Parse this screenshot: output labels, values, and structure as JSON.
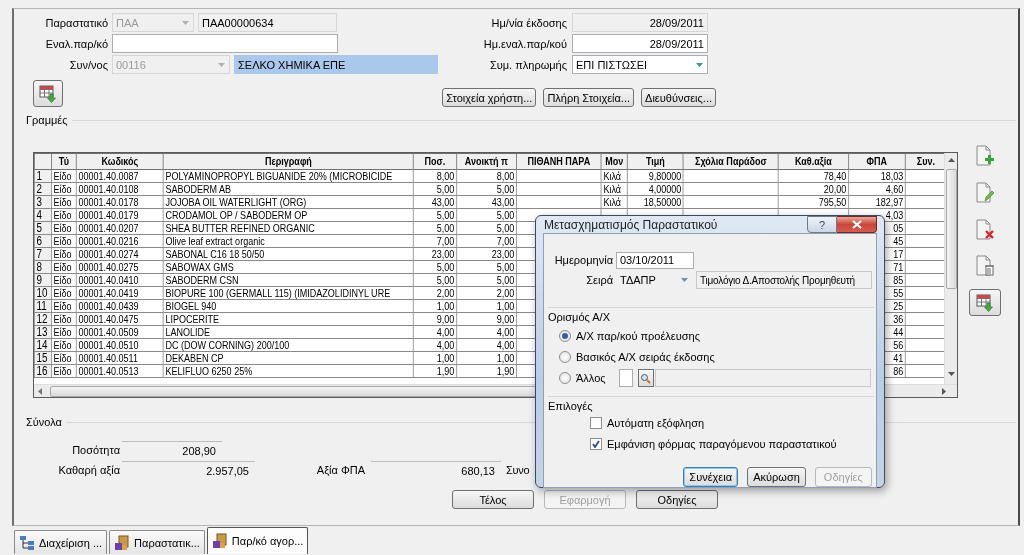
{
  "document": {
    "label": "Παραστατικό",
    "series": {
      "value": "ΠΑΑ",
      "disabled": true
    },
    "number": {
      "value": "ΠΑΑ00000634",
      "disabled": true
    }
  },
  "alt_document": {
    "label": "Εναλ.παρ/κό"
  },
  "supplier": {
    "label": "Συν/νος",
    "code": {
      "value": "00116",
      "disabled": true
    },
    "name": {
      "value": "ΣΕΛΚΟ ΧΗΜΙΚΑ ΕΠΕ",
      "selected": true
    }
  },
  "issue_date": {
    "label": "Ημ/νία έκδοσης",
    "value": "28/09/2011",
    "disabled": true
  },
  "alt_date": {
    "label": "Ημ.εναλ.παρ/κού",
    "value": "28/09/2011",
    "disabled": false
  },
  "payment": {
    "label": "Συμ. πληρωμής",
    "value": "ΕΠΙ ΠΙΣΤΩΣΕΙ"
  },
  "header_buttons": [
    "Στοιχεία χρήστη...",
    "Πλήρη Στοιχεία...",
    "Διευθύνσεις..."
  ],
  "lines": {
    "title": "Γραμμές",
    "columns": [
      {
        "label": "Τύ",
        "kind": "text"
      },
      {
        "label": "Κωδικός",
        "kind": "text"
      },
      {
        "label": "Περιγραφή",
        "kind": "text"
      },
      {
        "label": "Ποσ.",
        "kind": "number"
      },
      {
        "label": "Ανοικτή π",
        "kind": "number"
      },
      {
        "label": "ΠΙΘΑΝΗ ΠΑΡΑ",
        "kind": "text"
      },
      {
        "label": "Μον",
        "kind": "text"
      },
      {
        "label": "Τιμή",
        "kind": "number"
      },
      {
        "label": "Σχόλια Παράδοσ",
        "kind": "text"
      },
      {
        "label": "Καθ.αξία",
        "kind": "number"
      },
      {
        "label": "ΦΠΑ",
        "kind": "number"
      },
      {
        "label": "Συν.",
        "kind": "number"
      }
    ],
    "rows": [
      {
        "number": "1",
        "cells": [
          "Είδο",
          "00001.40.0087",
          "POLYAMINOPROPYL BIGUANIDE 20% (MICROBICIDE",
          "8,00",
          "8,00",
          null,
          "Κιλά",
          "9,80000",
          null,
          "78,40",
          "18,03",
          null
        ]
      },
      {
        "number": "2",
        "cells": [
          "Είδο",
          "00001.40.0108",
          "SABODERM AB",
          "5,00",
          "5,00",
          null,
          "Κιλά",
          "4,00000",
          null,
          "20,00",
          "4,60",
          null
        ]
      },
      {
        "number": "3",
        "cells": [
          "Είδο",
          "00001.40.0178",
          "JOJOBA OIL WATERLIGHT (ORG)",
          "43,00",
          "43,00",
          null,
          "Κιλά",
          "18,50000",
          null,
          "795,50",
          "182,97",
          null
        ]
      },
      {
        "number": "4",
        "cells": [
          "Είδο",
          "00001.40.0179",
          "CRODAMOL OP / SABODERM OP",
          "5,00",
          "5,00",
          null,
          null,
          null,
          null,
          null,
          "4,03",
          null
        ]
      },
      {
        "number": "5",
        "cells": [
          "Είδο",
          "00001.40.0207",
          "SHEA BUTTER REFINED ORGANIC",
          "5,00",
          "5,00",
          null,
          null,
          null,
          null,
          null,
          "05",
          null
        ]
      },
      {
        "number": "6",
        "cells": [
          "Είδο",
          "00001.40.0216",
          "Olive leaf extract organic",
          "7,00",
          "7,00",
          null,
          null,
          null,
          null,
          null,
          "45",
          null
        ]
      },
      {
        "number": "7",
        "cells": [
          "Είδο",
          "00001.40.0274",
          "SABONAL C16 18 50/50",
          "23,00",
          "23,00",
          null,
          null,
          null,
          null,
          null,
          "17",
          null
        ]
      },
      {
        "number": "8",
        "cells": [
          "Είδο",
          "00001.40.0275",
          "SABOWAX GMS",
          "5,00",
          "5,00",
          null,
          null,
          null,
          null,
          null,
          "71",
          null
        ]
      },
      {
        "number": "9",
        "cells": [
          "Είδο",
          "00001.40.0410",
          "SABODERM CSN",
          "5,00",
          "5,00",
          null,
          null,
          null,
          null,
          null,
          "85",
          null
        ]
      },
      {
        "number": "10",
        "cells": [
          "Είδο",
          "00001.40.0419",
          "BIOPURE 100 (GERMALL 115) (IMIDAZOLIDINYL URE",
          "2,00",
          "2,00",
          null,
          null,
          null,
          null,
          null,
          "55",
          null
        ]
      },
      {
        "number": "11",
        "cells": [
          "Είδο",
          "00001.40.0439",
          "BIOGEL 940",
          "1,00",
          "1,00",
          null,
          null,
          null,
          null,
          null,
          "25",
          null
        ]
      },
      {
        "number": "12",
        "cells": [
          "Είδο",
          "00001.40.0475",
          "LIPOCERITE",
          "9,00",
          "9,00",
          null,
          null,
          null,
          null,
          null,
          "36",
          null
        ]
      },
      {
        "number": "13",
        "cells": [
          "Είδο",
          "00001.40.0509",
          "LANOLIDE",
          "4,00",
          "4,00",
          null,
          null,
          null,
          null,
          null,
          "44",
          null
        ]
      },
      {
        "number": "14",
        "cells": [
          "Είδο",
          "00001.40.0510",
          "DC (DOW CORNING) 200/100",
          "4,00",
          "4,00",
          null,
          null,
          null,
          null,
          null,
          "56",
          null
        ]
      },
      {
        "number": "15",
        "cells": [
          "Είδο",
          "00001.40.0511",
          "DEKABEN CP",
          "1,00",
          "1,00",
          null,
          null,
          null,
          null,
          null,
          "41",
          null
        ]
      },
      {
        "number": "16",
        "cells": [
          "Είδο",
          "00001.40.0513",
          "KELIFLUO 6250 25%",
          "1,90",
          "1,90",
          null,
          null,
          null,
          null,
          null,
          "86",
          null
        ]
      }
    ]
  },
  "totals": {
    "title": "Σύνολα",
    "quantity": {
      "label": "Ποσότητα",
      "value": "208,90"
    },
    "net": {
      "label": "Καθαρή αξία",
      "value": "2.957,05"
    },
    "vat": {
      "label": "Αξία ΦΠΑ",
      "value": "680,13"
    },
    "total_label": "Συνο"
  },
  "buttons": [
    {
      "label": "Τέλος",
      "disabled": false
    },
    {
      "label": "Εφαρμογή",
      "disabled": true
    },
    {
      "label": "Οδηγίες",
      "disabled": false
    }
  ],
  "dialog": {
    "title": "Μετασχηματισμός Παραστατικού",
    "help": "?",
    "date": {
      "label": "Ημερομηνία",
      "value": "03/10/2011"
    },
    "series": {
      "label": "Σειρά",
      "value": "ΤΔΑΠΡ",
      "description": "Τιμολόγιο Δ.Αποστολής Προμηθευτή"
    },
    "account": {
      "title": "Ορισμός Α/Χ",
      "options": [
        {
          "label": "Α/Χ παρ/κού προέλευσης",
          "selected": true,
          "kind": "plain"
        },
        {
          "label": "Βασικός Α/Χ σειράς έκδοσης",
          "selected": false,
          "kind": "plain"
        },
        {
          "label": "Άλλος",
          "selected": false,
          "kind": "lookup"
        }
      ]
    },
    "options": {
      "title": "Επιλογές",
      "items": [
        {
          "label": "Αυτόματη εξόφληση",
          "checked": false
        },
        {
          "label": "Εμφάνιση φόρμας παραγόμενου παραστατικού",
          "checked": true
        }
      ]
    },
    "buttons": [
      {
        "label": "Συνέχεια",
        "disabled": false,
        "default": true
      },
      {
        "label": "Ακύρωση",
        "disabled": false,
        "default": false
      },
      {
        "label": "Οδηγίες",
        "disabled": true,
        "default": false
      }
    ]
  },
  "taskbar_tabs": [
    {
      "label": "Διαχείριση ...",
      "selected": false,
      "kind": "tree"
    },
    {
      "label": "Παραστατικ...",
      "selected": false,
      "kind": "docs"
    },
    {
      "label": "Παρ/κό αγορ...",
      "selected": true,
      "kind": "docs"
    }
  ]
}
